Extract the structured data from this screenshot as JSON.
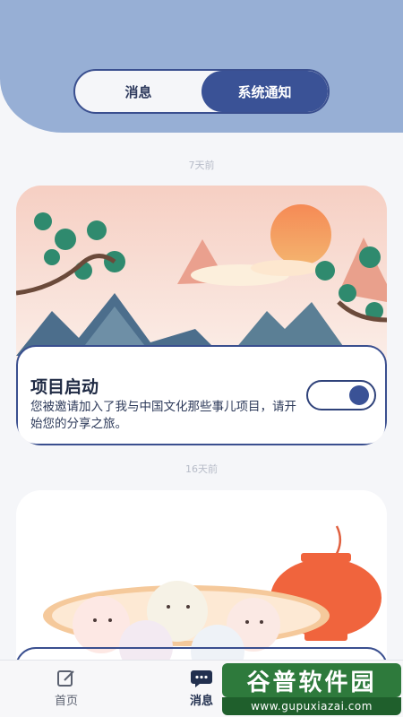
{
  "tabs": [
    {
      "label": "消息",
      "active": false
    },
    {
      "label": "系统通知",
      "active": true
    }
  ],
  "notices": [
    {
      "time": "7天前",
      "title": "项目启动",
      "description": "您被邀请加入了我与中国文化那些事儿项目，请开始您的分享之旅。",
      "toggle_on": true
    },
    {
      "time": "16天前"
    }
  ],
  "bottom_nav": [
    {
      "label": "首页",
      "icon": "edit-square-icon",
      "active": false
    },
    {
      "label": "消息",
      "icon": "chat-bubble-icon",
      "active": true
    }
  ],
  "watermark": {
    "title": "谷普软件园",
    "url": "www.gupuxiazai.com"
  },
  "colors": {
    "header": "#97afd5",
    "accent": "#3a5296",
    "outline": "#3a4f8f",
    "background": "#f5f6f9"
  }
}
